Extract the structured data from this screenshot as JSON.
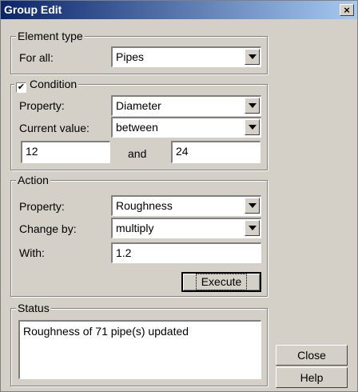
{
  "window": {
    "title": "Group Edit",
    "close_glyph": "×"
  },
  "element_type": {
    "legend": "Element type",
    "for_all_label": "For all:",
    "for_all_value": "Pipes"
  },
  "condition": {
    "legend": "Condition",
    "checked": true,
    "property_label": "Property:",
    "property_value": "Diameter",
    "current_value_label": "Current value:",
    "current_value_value": "between",
    "low": "12",
    "and_label": "and",
    "high": "24"
  },
  "action": {
    "legend": "Action",
    "property_label": "Property:",
    "property_value": "Roughness",
    "change_by_label": "Change by:",
    "change_by_value": "multiply",
    "with_label": "With:",
    "with_value": "1.2",
    "execute_label": "Execute"
  },
  "status": {
    "legend": "Status",
    "message": "Roughness of 71 pipe(s) updated"
  },
  "buttons": {
    "close": "Close",
    "help": "Help"
  }
}
